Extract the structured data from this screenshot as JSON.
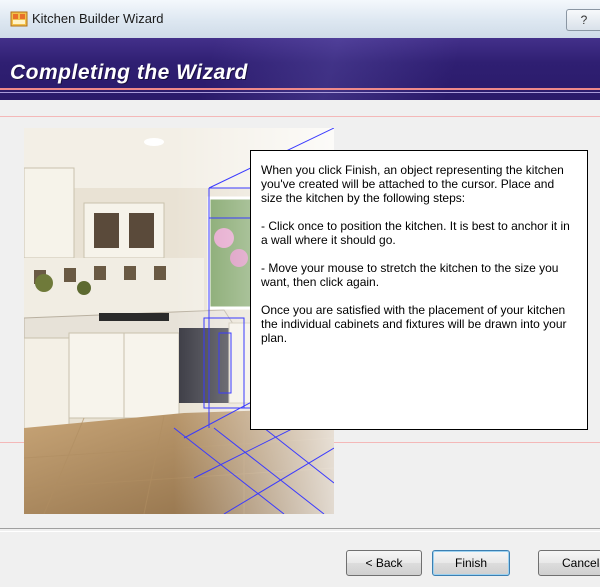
{
  "window": {
    "title": "Kitchen Builder Wizard",
    "help_label": "?",
    "icon": "kitchen-app-icon"
  },
  "banner": {
    "title": "Completing the Wizard"
  },
  "info": {
    "paragraph1": "When you click Finish, an object representing the kitchen you've created will be attached to the cursor. Place and size the kitchen by the following steps:",
    "paragraph2": "- Click once to position the kitchen. It is best to anchor it in a wall where it should go.",
    "paragraph3": "- Move your mouse to stretch the kitchen to the size you want, then click again.",
    "paragraph4": "Once you are satisfied with the placement of your kitchen the individual cabinets and fixtures will be drawn into your plan."
  },
  "buttons": {
    "back": "< Back",
    "finish": "Finish",
    "cancel": "Cancel"
  },
  "colors": {
    "banner": "#2f1f72",
    "wireframe": "#3a3aff"
  }
}
